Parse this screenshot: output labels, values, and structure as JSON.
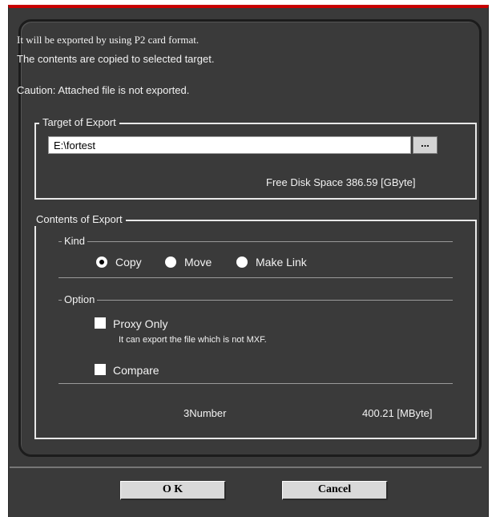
{
  "intro": {
    "line1": "It will be exported by using P2 card format.",
    "line2": "The contents are copied to selected target.",
    "caution": "Caution: Attached file is not exported."
  },
  "target": {
    "legend": "Target of Export",
    "path_value": "E:\\fortest",
    "browse_label": "...",
    "free_space_label": "Free Disk Space",
    "free_space_value": "386.59",
    "free_space_unit": "[GByte]"
  },
  "contents": {
    "legend": "Contents of Export",
    "kind_label": "Kind",
    "kind_options": [
      {
        "label": "Copy",
        "selected": true
      },
      {
        "label": "Move",
        "selected": false
      },
      {
        "label": "Make Link",
        "selected": false
      }
    ],
    "option_label": "Option",
    "proxy_only": {
      "label": "Proxy Only",
      "checked": false,
      "note": "It can export the file which is not MXF."
    },
    "compare": {
      "label": "Compare",
      "checked": false
    },
    "count": "3Number",
    "size": "400.21 [MByte]"
  },
  "buttons": {
    "ok": "O K",
    "cancel": "Cancel"
  },
  "colors": {
    "window_bg": "#3a3a3a",
    "title_accent": "#c80000",
    "button_bg": "#d9d9d9"
  }
}
